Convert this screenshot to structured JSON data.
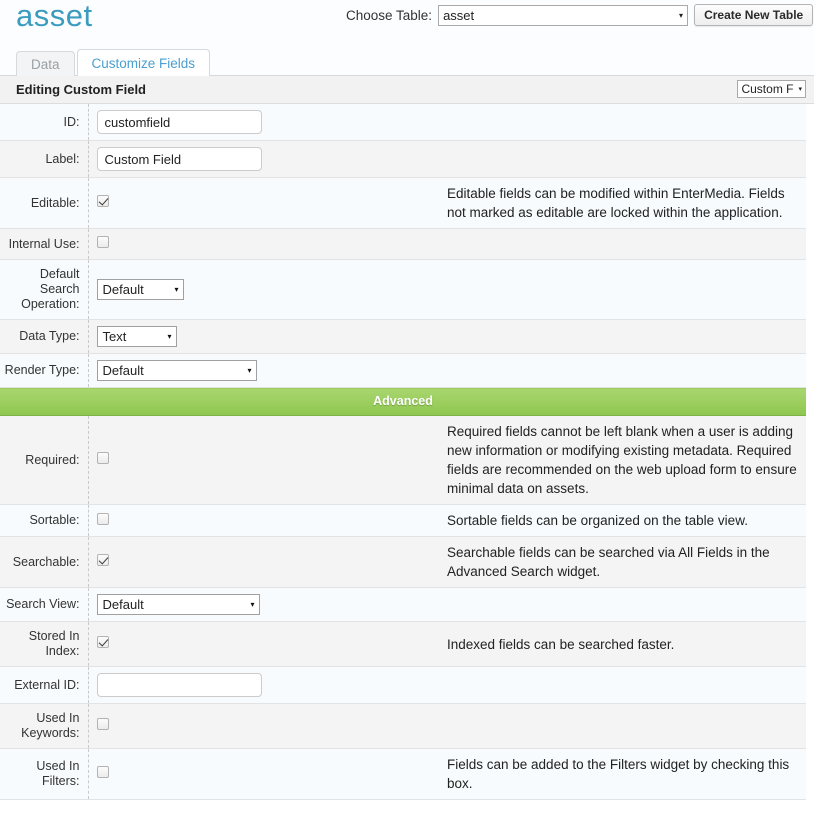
{
  "header": {
    "brand": "asset",
    "choose_table_label": "Choose Table:",
    "choose_table_value": "asset",
    "create_new_table_label": "Create New Table"
  },
  "tabs": [
    {
      "label": "Data",
      "active": false
    },
    {
      "label": "Customize Fields",
      "active": true
    }
  ],
  "edit_header": {
    "title": "Editing Custom Field",
    "view_select_value": "Custom F"
  },
  "rows": [
    {
      "label": "ID:",
      "kind": "text",
      "value": "customfield",
      "desc": ""
    },
    {
      "label": "Label:",
      "kind": "text",
      "value": "Custom Field",
      "desc": ""
    },
    {
      "label": "Editable:",
      "kind": "checkbox",
      "checked": true,
      "desc": "Editable fields can be modified within EnterMedia. Fields not marked as editable are locked within the application."
    },
    {
      "label": "Internal Use:",
      "kind": "checkbox",
      "checked": false,
      "desc": ""
    },
    {
      "label": "Default Search Operation:",
      "kind": "select",
      "value": "Default",
      "width": "w87",
      "desc": ""
    },
    {
      "label": "Data Type:",
      "kind": "select",
      "value": "Text",
      "width": "w80",
      "desc": ""
    },
    {
      "label": "Render Type:",
      "kind": "select",
      "value": "Default",
      "width": "w160",
      "desc": ""
    },
    {
      "label": "Advanced",
      "kind": "section"
    },
    {
      "label": "Required:",
      "kind": "checkbox",
      "checked": false,
      "desc": "Required fields cannot be left blank when a user is adding new information or modifying existing metadata. Required fields are recommended on the web upload form to ensure minimal data on assets."
    },
    {
      "label": "Sortable:",
      "kind": "checkbox",
      "checked": false,
      "desc": "Sortable fields can be organized on the table view."
    },
    {
      "label": "Searchable:",
      "kind": "checkbox",
      "checked": true,
      "desc": "Searchable fields can be searched via All Fields in the Advanced Search widget."
    },
    {
      "label": "Search View:",
      "kind": "select",
      "value": "Default",
      "width": "w163",
      "desc": ""
    },
    {
      "label": "Stored In Index:",
      "kind": "checkbox",
      "checked": true,
      "desc": "Indexed fields can be searched faster."
    },
    {
      "label": "External ID:",
      "kind": "text",
      "value": "",
      "desc": ""
    },
    {
      "label": "Used In Keywords:",
      "kind": "checkbox",
      "checked": false,
      "desc": ""
    },
    {
      "label": "Used In Filters:",
      "kind": "checkbox",
      "checked": false,
      "desc": "Fields can be added to the Filters widget by checking this box."
    }
  ],
  "icons": {
    "caret_down": "▾"
  },
  "colors": {
    "brand": "#3b9cc0",
    "tab_active_text": "#4a9fd0",
    "advanced_bar": "#8ec64f",
    "row_odd": "#f7fbfd",
    "row_even": "#f4f4f4"
  }
}
